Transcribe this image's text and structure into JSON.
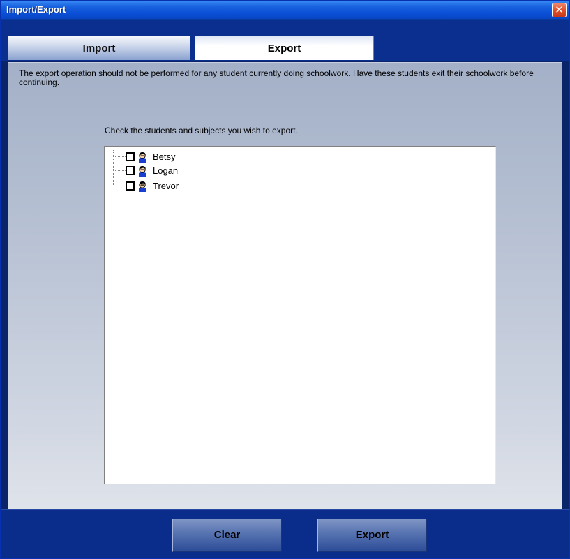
{
  "window": {
    "title": "Import/Export",
    "close_glyph": "✕"
  },
  "tabs": [
    {
      "label": "Import",
      "active": false
    },
    {
      "label": "Export",
      "active": true
    }
  ],
  "panel": {
    "instructions": "The export operation should not be performed for any student currently doing schoolwork.  Have these students exit their schoolwork before continuing.",
    "check_label": "Check the students and subjects you wish to export."
  },
  "students": [
    {
      "name": "Betsy",
      "checked": false,
      "icon": "student-icon"
    },
    {
      "name": "Logan",
      "checked": false,
      "icon": "student-icon"
    },
    {
      "name": "Trevor",
      "checked": false,
      "icon": "student-icon"
    }
  ],
  "buttons": {
    "clear_label": "Clear",
    "export_label": "Export"
  },
  "colors": {
    "titlebar": "#0a4fd6",
    "frame": "#0a2c8a",
    "close": "#e0502a"
  }
}
